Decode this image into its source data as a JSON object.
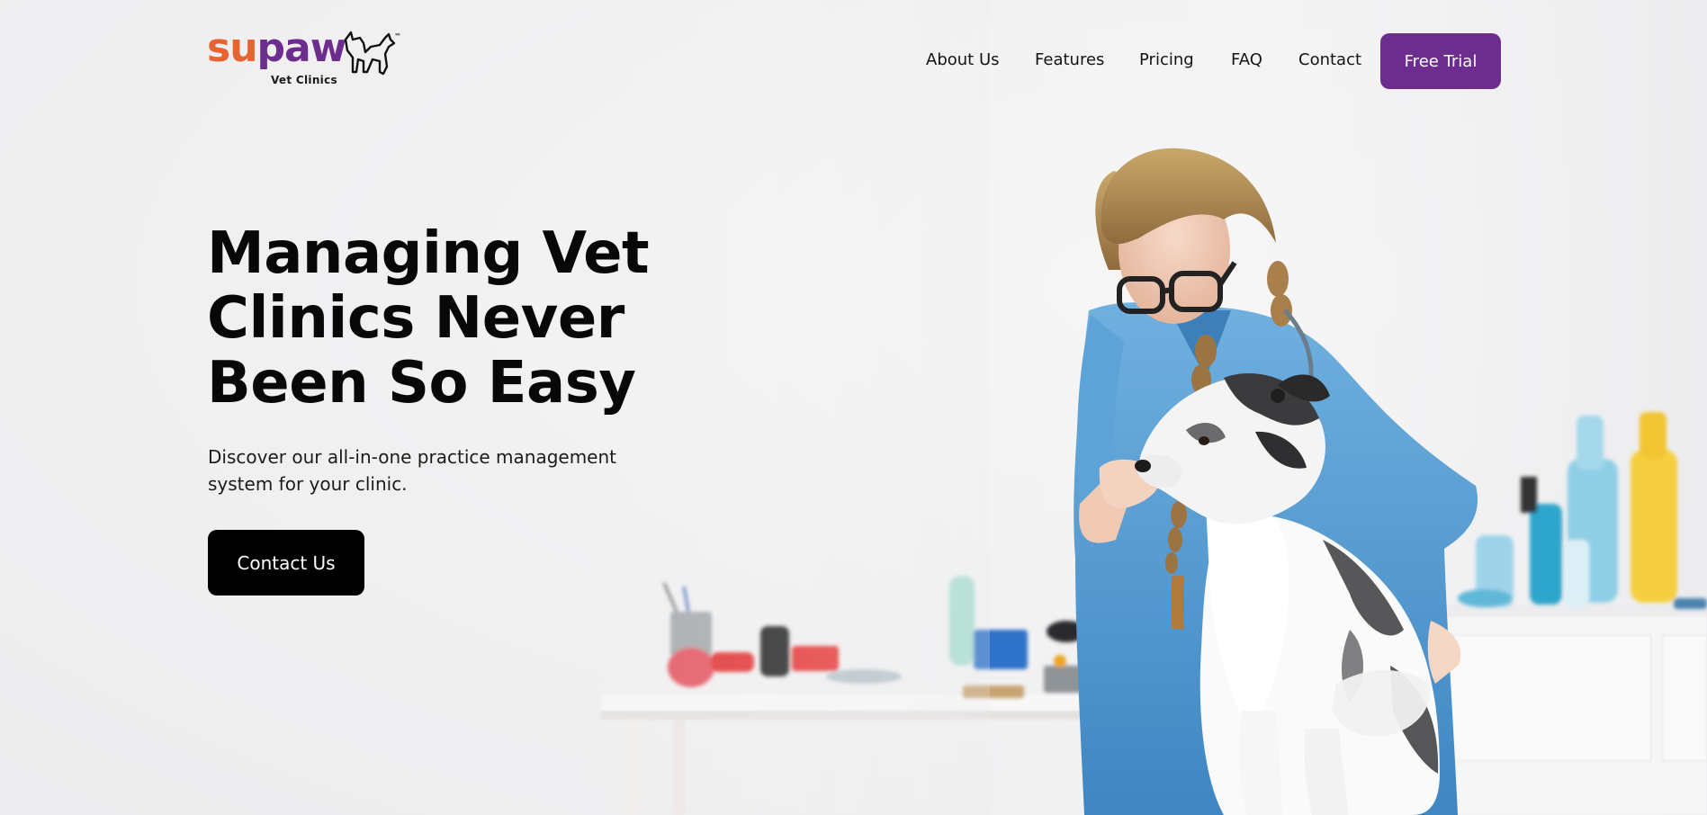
{
  "brand": {
    "logo_su": "su",
    "logo_paw": "paw",
    "logo_sub": "Vet Clinics",
    "logo_tm": "™",
    "color_orange": "#e7632f",
    "color_purple": "#6c2d8e"
  },
  "nav": {
    "items": [
      {
        "label": "About Us"
      },
      {
        "label": "Features"
      },
      {
        "label": "Pricing"
      },
      {
        "label": "FAQ"
      },
      {
        "label": "Contact"
      }
    ],
    "cta_label": "Free Trial"
  },
  "hero": {
    "title": "Managing Vet Clinics Never Been So Easy",
    "description": "Discover our all-in-one practice management system for your clinic.",
    "cta_label": "Contact Us"
  },
  "image": {
    "subject": "vet-with-dog-photo"
  }
}
